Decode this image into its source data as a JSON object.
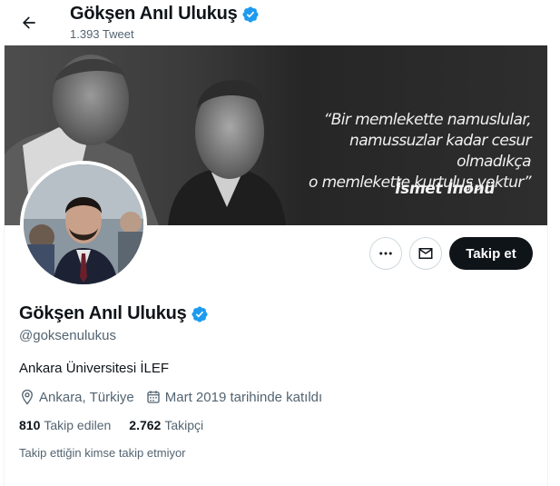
{
  "header": {
    "name": "Gökşen Anıl Ulukuş",
    "tweet_count": "1.393 Tweet",
    "verified_icon": "verified-badge-icon",
    "back_icon": "arrow-left-icon"
  },
  "banner": {
    "quote": "“Bir memlekette namuslular,\nnamussuzlar kadar cesur olmadıkça\no memlekette kurtuluş yoktur”",
    "author": "İsmet İnönü"
  },
  "actions": {
    "more_icon": "more-dots-icon",
    "message_icon": "envelope-icon",
    "follow_label": "Takip et"
  },
  "profile": {
    "name": "Gökşen Anıl Ulukuş",
    "handle": "@goksenulukus",
    "bio": "Ankara Üniversitesi İLEF",
    "location": "Ankara, Türkiye",
    "joined": "Mart 2019 tarihinde katıldı",
    "following_count": "810",
    "following_label": "Takip edilen",
    "followers_count": "2.762",
    "followers_label": "Takipçi",
    "followers_you_know": "Takip ettiğin kimse takip etmiyor"
  },
  "colors": {
    "verified": "#1d9bf0",
    "text": "#0f1419",
    "secondary": "#536471",
    "follow_bg": "#0f1419"
  }
}
